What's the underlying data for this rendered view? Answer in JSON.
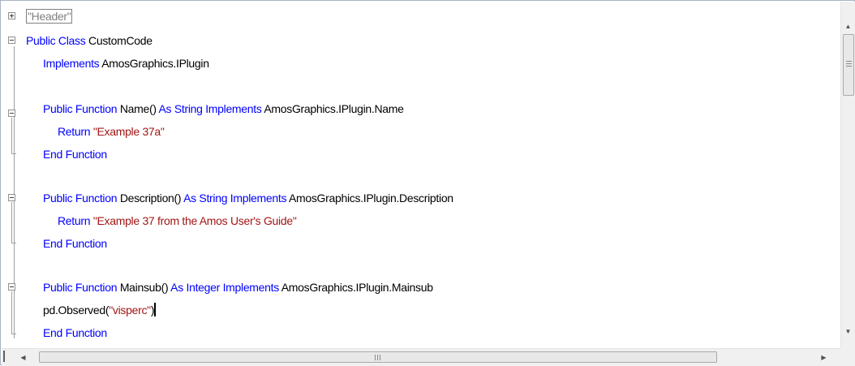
{
  "editor": {
    "lines": [
      [
        {
          "t": "\"Header\"",
          "c": "header-region"
        }
      ],
      [
        {
          "t": "Public Class ",
          "c": "kw"
        },
        {
          "t": "CustomCode",
          "c": ""
        }
      ],
      [
        {
          "t": "Implements ",
          "c": "kw"
        },
        {
          "t": "AmosGraphics.IPlugin",
          "c": ""
        }
      ],
      [],
      [
        {
          "t": "Public Function ",
          "c": "kw"
        },
        {
          "t": "Name() ",
          "c": ""
        },
        {
          "t": "As String Implements ",
          "c": "kw"
        },
        {
          "t": "AmosGraphics.IPlugin.Name",
          "c": ""
        }
      ],
      [
        {
          "t": "Return ",
          "c": "kw"
        },
        {
          "t": "\"Example 37a\"",
          "c": "str"
        }
      ],
      [
        {
          "t": "End Function",
          "c": "kw"
        }
      ],
      [],
      [
        {
          "t": "Public Function ",
          "c": "kw"
        },
        {
          "t": "Description() ",
          "c": ""
        },
        {
          "t": "As String Implements ",
          "c": "kw"
        },
        {
          "t": "AmosGraphics.IPlugin.Description",
          "c": ""
        }
      ],
      [
        {
          "t": "Return ",
          "c": "kw"
        },
        {
          "t": "\"Example 37 from the Amos User's Guide\"",
          "c": "str"
        }
      ],
      [
        {
          "t": "End Function",
          "c": "kw"
        }
      ],
      [],
      [
        {
          "t": "Public Function ",
          "c": "kw"
        },
        {
          "t": "Mainsub() ",
          "c": ""
        },
        {
          "t": "As Integer Implements ",
          "c": "kw"
        },
        {
          "t": "AmosGraphics.IPlugin.Mainsub",
          "c": ""
        }
      ],
      [
        {
          "t": "pd.Observed(",
          "c": ""
        },
        {
          "t": "\"visperc\"",
          "c": "str"
        },
        {
          "t": ")",
          "c": ""
        },
        {
          "t": "",
          "c": "caret"
        }
      ],
      [
        {
          "t": "End Function",
          "c": "kw"
        }
      ]
    ],
    "horizontal_scrollbar_grip": "III",
    "vertical_scrollbar_grip": "≡"
  },
  "icons": {
    "fold_collapsed": "plus-box",
    "fold_expanded": "minus-box",
    "scroll_up": "▲",
    "scroll_down": "▼",
    "scroll_left": "◀",
    "scroll_right": "▶"
  }
}
